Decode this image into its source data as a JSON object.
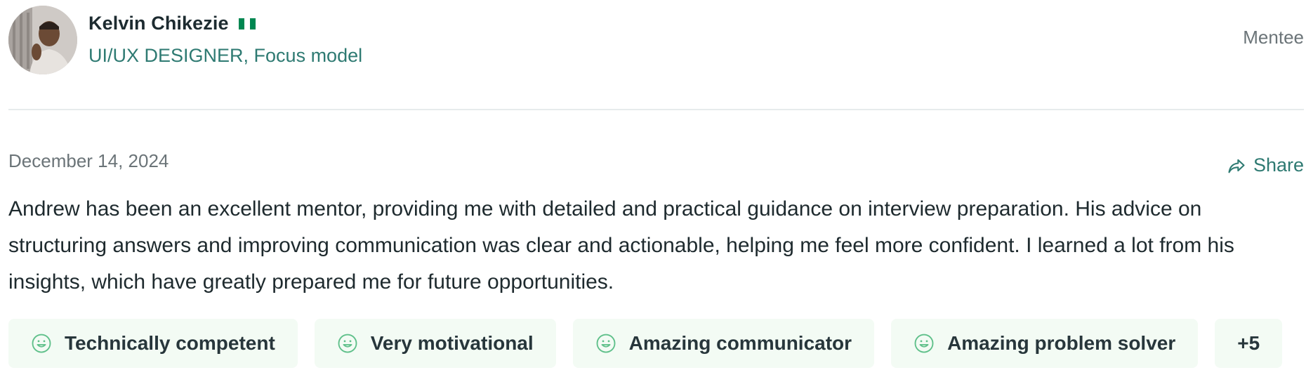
{
  "profile": {
    "name": "Kelvin Chikezie",
    "flag_icon": "nigeria-flag-icon",
    "flag_colors": [
      "#008751",
      "#ffffff",
      "#008751"
    ],
    "subtitle": "UI/UX DESIGNER, Focus model",
    "badge": "Mentee"
  },
  "review": {
    "date": "December 14, 2024",
    "share_label": "Share",
    "share_icon": "share-arrow-icon",
    "text": "Andrew has been an excellent mentor, providing me with detailed and practical guidance on interview preparation. His advice on structuring answers and improving communication was clear and actionable, helping me feel more confident. I learned a lot from his insights, which have greatly prepared me for future opportunities."
  },
  "tags": {
    "icon": "smile-icon",
    "items": [
      {
        "label": "Technically competent"
      },
      {
        "label": "Very motivational"
      },
      {
        "label": "Amazing communicator"
      },
      {
        "label": "Amazing problem solver"
      }
    ],
    "more_label": "+5"
  },
  "colors": {
    "accent": "#2e7a72",
    "chip_bg": "#f3fbf4",
    "smile": "#5fc08a",
    "muted": "#6b7478"
  }
}
